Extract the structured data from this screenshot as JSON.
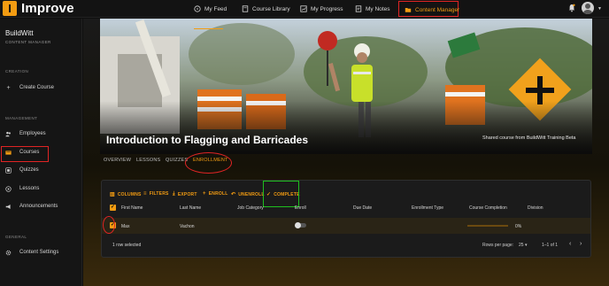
{
  "app": {
    "logo_letter": "I",
    "name": "Improve"
  },
  "nav": {
    "items": [
      {
        "label": "My Feed",
        "icon": "compass-icon"
      },
      {
        "label": "Course Library",
        "icon": "book-icon"
      },
      {
        "label": "My Progress",
        "icon": "chart-icon"
      },
      {
        "label": "My Notes",
        "icon": "note-icon"
      },
      {
        "label": "Content Manager",
        "icon": "folder-icon",
        "active": true
      }
    ]
  },
  "sidebar": {
    "org_name": "BuildWitt",
    "org_role": "CONTENT MANAGER",
    "creation_label": "CREATION",
    "create_course": "Create Course",
    "management_label": "MANAGEMENT",
    "management_items": [
      {
        "label": "Employees",
        "icon": "people-icon"
      },
      {
        "label": "Courses",
        "icon": "courses-icon",
        "active": true
      },
      {
        "label": "Quizzes",
        "icon": "quiz-icon"
      },
      {
        "label": "Lessons",
        "icon": "play-icon"
      },
      {
        "label": "Announcements",
        "icon": "megaphone-icon"
      }
    ],
    "general_label": "GENERAL",
    "content_settings": "Content Settings"
  },
  "course": {
    "title": "Introduction to Flagging and Barricades",
    "shared_text": "Shared course from BuildWitt Training Beta"
  },
  "tabs": [
    "OVERVIEW",
    "LESSONS",
    "QUIZZES",
    "ENROLLMENT"
  ],
  "active_tab": "ENROLLMENT",
  "toolbar": {
    "columns": "COLUMNS",
    "filters": "FILTERS",
    "export": "EXPORT",
    "enroll": "ENROLL",
    "unenroll": "UNENROLL",
    "complete": "COMPLETE"
  },
  "table": {
    "headers": [
      "First Name",
      "Last Name",
      "Job Category",
      "Enroll",
      "Due Date",
      "Enrollment Type",
      "Course Completion",
      "Division"
    ],
    "rows": [
      {
        "first_name": "Max",
        "last_name": "Vachon",
        "job_category": "",
        "enrolled": false,
        "due_date": "",
        "enrollment_type": "",
        "completion_percent": 0,
        "completion_label": "0%",
        "division": ""
      }
    ],
    "selected_text": "1 row selected",
    "rows_per_page_label": "Rows per page:",
    "rows_per_page": "25",
    "range": "1–1 of 1"
  },
  "colors": {
    "accent": "#f39c12",
    "highlight_red": "#e02424",
    "highlight_green": "#1fbe1f"
  }
}
